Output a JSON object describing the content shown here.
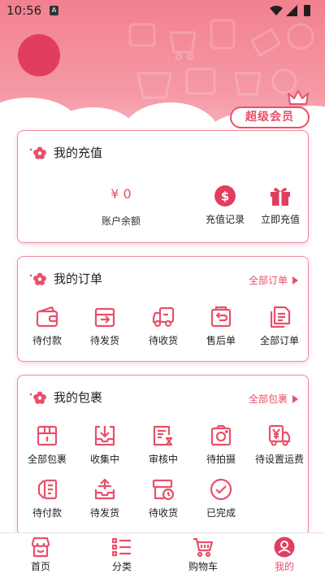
{
  "status_bar": {
    "time": "10:56",
    "notification_badge": "A",
    "icons": [
      "wifi-icon",
      "signal-icon",
      "battery-icon"
    ]
  },
  "profile": {
    "vip_label": "超级会员"
  },
  "recharge": {
    "title": "我的充值",
    "balance_value": "¥ 0",
    "balance_label": "账户余额",
    "actions": [
      {
        "label": "充值记录",
        "icon": "dollar-icon"
      },
      {
        "label": "立即充值",
        "icon": "gift-icon"
      }
    ]
  },
  "orders": {
    "title": "我的订单",
    "more_label": "全部订单",
    "items": [
      {
        "label": "待付款",
        "icon": "wallet-icon"
      },
      {
        "label": "待发货",
        "icon": "ship-box-icon"
      },
      {
        "label": "待收货",
        "icon": "truck-icon"
      },
      {
        "label": "售后单",
        "icon": "return-icon"
      },
      {
        "label": "全部订单",
        "icon": "documents-icon"
      }
    ]
  },
  "parcels": {
    "title": "我的包裹",
    "more_label": "全部包裹",
    "items": [
      {
        "label": "全部包裹",
        "icon": "package-icon"
      },
      {
        "label": "收集中",
        "icon": "inbox-download-icon"
      },
      {
        "label": "审核中",
        "icon": "review-icon"
      },
      {
        "label": "待拍摄",
        "icon": "camera-icon"
      },
      {
        "label": "待设置运费",
        "icon": "yen-truck-icon"
      },
      {
        "label": "待付款",
        "icon": "pay-icon"
      },
      {
        "label": "待发货",
        "icon": "tray-upload-icon"
      },
      {
        "label": "待收货",
        "icon": "clock-box-icon"
      },
      {
        "label": "已完成",
        "icon": "check-circle-icon"
      }
    ]
  },
  "tabbar": {
    "tabs": [
      {
        "label": "首页",
        "icon": "shop-icon"
      },
      {
        "label": "分类",
        "icon": "list-icon"
      },
      {
        "label": "购物车",
        "icon": "cart-icon"
      },
      {
        "label": "我的",
        "icon": "user-icon",
        "active": true
      }
    ]
  },
  "colors": {
    "accent": "#e8506a",
    "header": "#f2808f",
    "avatar": "#e13e5f"
  }
}
